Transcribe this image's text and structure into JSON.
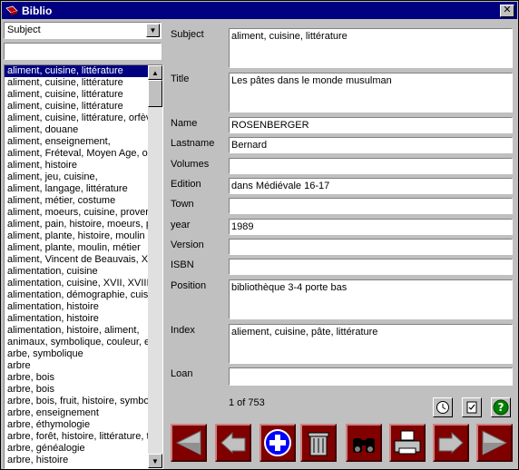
{
  "window": {
    "title": "Biblio",
    "close_glyph": "✕"
  },
  "left_panel": {
    "combo_value": "Subject",
    "search_value": "",
    "list_items": [
      "aliment, cuisine, littérature",
      "aliment, cuisine, littérature",
      "aliment, cuisine, littérature",
      "aliment, cuisine, littérature",
      "aliment, cuisine, littérature, orfèvr",
      "aliment, douane",
      "aliment, enseignement,",
      "aliment, Fréteval, Moyen Age, ou",
      "aliment, histoire",
      "aliment, jeu, cuisine,",
      "aliment, langage, littérature",
      "aliment, métier, costume",
      "aliment, moeurs, cuisine, proverbe",
      "aliment, pain, histoire, moeurs, pr",
      "aliment, plante, histoire, moulin",
      "aliment, plante, moulin, métier",
      "aliment, Vincent de Beauvais, XII",
      "alimentation, cuisine",
      "alimentation, cuisine,  XVII, XVIIIe",
      "alimentation, démographie, cuisin",
      "alimentation, histoire",
      "alimentation, histoire",
      "alimentation, histoire, aliment,",
      "animaux, symbolique, couleur, ex",
      "arbe, symbolique",
      "arbre",
      "arbre, bois",
      "arbre, bois",
      "arbre, bois, fruit, histoire, symbolic",
      "arbre, enseignement",
      "arbre, éthymologie",
      "arbre, forêt, histoire, littérature, ta",
      "arbre, généalogie",
      "arbre, histoire"
    ],
    "selected_index": 0
  },
  "form": {
    "subject_label": "Subject",
    "subject_value": "aliment, cuisine, littérature",
    "title_label": "Title",
    "title_value": "Les pâtes dans le monde musulman",
    "name_label": "Name",
    "name_value": "ROSENBERGER",
    "lastname_label": "Lastname",
    "lastname_value": "Bernard",
    "volumes_label": "Volumes",
    "volumes_value": "",
    "edition_label": "Edition",
    "edition_value": "dans Médiévale 16-17",
    "town_label": "Town",
    "town_value": "",
    "year_label": "year",
    "year_value": "1989",
    "version_label": "Version",
    "version_value": "",
    "isbn_label": "ISBN",
    "isbn_value": "",
    "position_label": "Position",
    "position_value": "bibliothèque 3-4 porte bas",
    "index_label": "Index",
    "index_value": "aliement, cuisine, pâte, littérature",
    "loan_label": "Loan",
    "loan_value": ""
  },
  "record_counter": "1 of 753",
  "icons": {
    "small": [
      "clock-icon",
      "checklist-icon",
      "help-icon"
    ],
    "nav": [
      "first-record-icon",
      "previous-record-icon",
      "add-icon",
      "trash-icon",
      "binoculars-icon",
      "printer-icon",
      "next-record-icon",
      "last-record-icon"
    ]
  },
  "colors": {
    "titlebar": "#000080",
    "nav_button": "#800000",
    "selection": "#000080",
    "help_green": "#008000",
    "add_blue": "#0000ff"
  }
}
